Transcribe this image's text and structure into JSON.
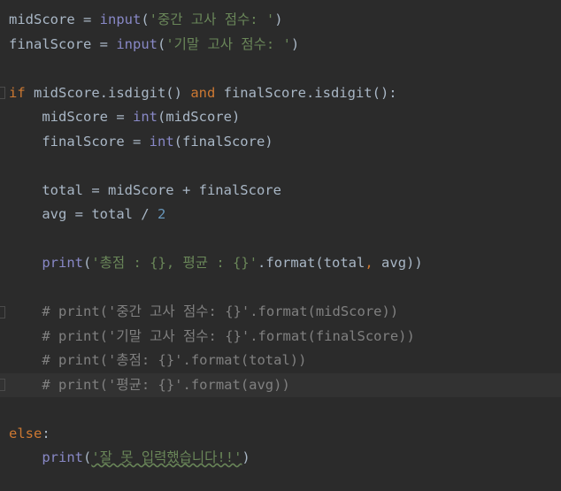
{
  "editor": {
    "language": "python",
    "theme": "darcula",
    "lines": [
      {
        "indent": "",
        "tokens": [
          [
            "t",
            "midScore = "
          ],
          [
            "fn",
            "input"
          ],
          [
            "t",
            "("
          ],
          [
            "str",
            "'중간 고사 점수: '"
          ],
          [
            "t",
            ")"
          ]
        ]
      },
      {
        "indent": "",
        "tokens": [
          [
            "t",
            "finalScore = "
          ],
          [
            "fn",
            "input"
          ],
          [
            "t",
            "("
          ],
          [
            "str",
            "'기말 고사 점수: '"
          ],
          [
            "t",
            ")"
          ]
        ]
      },
      {
        "indent": "",
        "tokens": []
      },
      {
        "indent": "",
        "tokens": [
          [
            "kw",
            "if "
          ],
          [
            "t",
            "midScore.isdigit() "
          ],
          [
            "kw",
            "and "
          ],
          [
            "t",
            "finalScore.isdigit():"
          ]
        ]
      },
      {
        "indent": "    ",
        "tokens": [
          [
            "t",
            "midScore = "
          ],
          [
            "fn",
            "int"
          ],
          [
            "t",
            "(midScore)"
          ]
        ]
      },
      {
        "indent": "    ",
        "tokens": [
          [
            "t",
            "finalScore = "
          ],
          [
            "fn",
            "int"
          ],
          [
            "t",
            "(finalScore)"
          ]
        ]
      },
      {
        "indent": "",
        "tokens": []
      },
      {
        "indent": "    ",
        "tokens": [
          [
            "t",
            "total = midScore + finalScore"
          ]
        ]
      },
      {
        "indent": "    ",
        "tokens": [
          [
            "t",
            "avg = total / "
          ],
          [
            "num",
            "2"
          ]
        ]
      },
      {
        "indent": "",
        "tokens": []
      },
      {
        "indent": "    ",
        "tokens": [
          [
            "fn",
            "print"
          ],
          [
            "t",
            "("
          ],
          [
            "str",
            "'총점 : {}, 평균 : {}'"
          ],
          [
            "t",
            ".format(total"
          ],
          [
            "kw",
            ", "
          ],
          [
            "t",
            "avg))"
          ]
        ]
      },
      {
        "indent": "",
        "tokens": []
      },
      {
        "indent": "    ",
        "tokens": [
          [
            "cm",
            "# print('중간 고사 점수: {}'.format(midScore))"
          ]
        ]
      },
      {
        "indent": "    ",
        "tokens": [
          [
            "cm",
            "# print('기말 고사 점수: {}'.format(finalScore))"
          ]
        ]
      },
      {
        "indent": "    ",
        "tokens": [
          [
            "cm",
            "# print('총점: {}'.format(total))"
          ]
        ]
      },
      {
        "indent": "    ",
        "tokens": [
          [
            "cm",
            "# print('평균: {}'.format(avg))"
          ]
        ]
      },
      {
        "indent": "",
        "tokens": []
      },
      {
        "indent": "",
        "tokens": [
          [
            "kw",
            "else"
          ],
          [
            "t",
            ":"
          ]
        ]
      },
      {
        "indent": "    ",
        "tokens": [
          [
            "fn",
            "print"
          ],
          [
            "t",
            "("
          ],
          [
            "strsq",
            "'잘 못 입력했습니다!!'"
          ],
          [
            "t",
            ")"
          ]
        ]
      }
    ],
    "current_line": 16
  },
  "colors": {
    "background": "#2b2b2b",
    "text": "#a9b7c6",
    "keyword": "#cc7832",
    "builtin": "#8888c6",
    "string": "#6a8759",
    "number": "#6897bb",
    "comment": "#808080"
  }
}
